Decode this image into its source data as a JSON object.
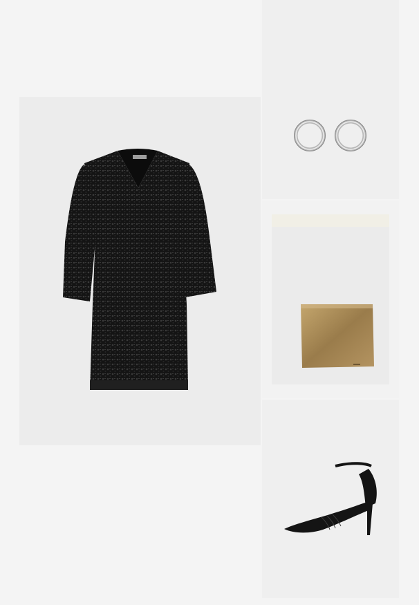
{
  "collage": {
    "items": [
      {
        "name": "sequin-dress",
        "icon": "sequin-dress-icon"
      },
      {
        "name": "hoop-earrings",
        "icon": "hoop-earrings-icon"
      },
      {
        "name": "gold-clutch",
        "icon": "clutch-bag-icon"
      },
      {
        "name": "black-pump",
        "icon": "high-heel-icon"
      }
    ],
    "colors": {
      "page_background": "#f4f4f4",
      "tile_background": "#ececec",
      "dress": "#151515",
      "silver": "#c9c9c9",
      "gold": "#a8895a",
      "shoe": "#141414"
    }
  }
}
